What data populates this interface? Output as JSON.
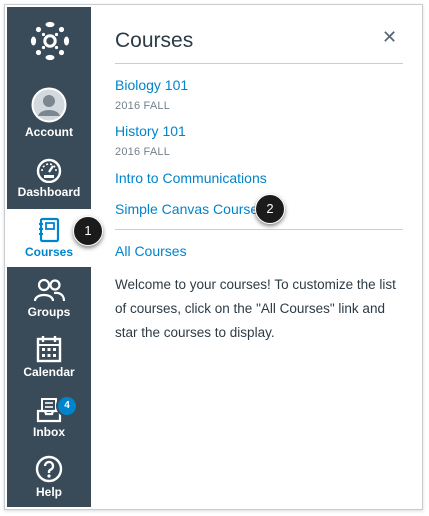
{
  "nav": {
    "items": [
      {
        "label": "Account",
        "icon": "account-avatar-icon"
      },
      {
        "label": "Dashboard",
        "icon": "dashboard-gauge-icon"
      },
      {
        "label": "Courses",
        "icon": "courses-book-icon",
        "active": true
      },
      {
        "label": "Groups",
        "icon": "groups-people-icon"
      },
      {
        "label": "Calendar",
        "icon": "calendar-icon"
      },
      {
        "label": "Inbox",
        "icon": "inbox-tray-icon",
        "badge": "4"
      },
      {
        "label": "Help",
        "icon": "help-question-icon"
      }
    ],
    "colors": {
      "background": "#394b58",
      "active_text": "#0084cc",
      "badge": "#0084cc"
    }
  },
  "tray": {
    "title": "Courses",
    "close_icon": "close-icon",
    "courses": [
      {
        "name": "Biology 101",
        "term": "2016 FALL"
      },
      {
        "name": "History 101",
        "term": "2016 FALL"
      },
      {
        "name": "Intro to Communications"
      },
      {
        "name": "Simple Canvas Course"
      }
    ],
    "all_courses": "All Courses",
    "welcome": "Welcome to your courses! To customize the list of courses, click on the \"All Courses\" link and star the courses to display.",
    "link_color": "#0084cc"
  },
  "callouts": {
    "courses_step": "1",
    "course_step": "2"
  }
}
